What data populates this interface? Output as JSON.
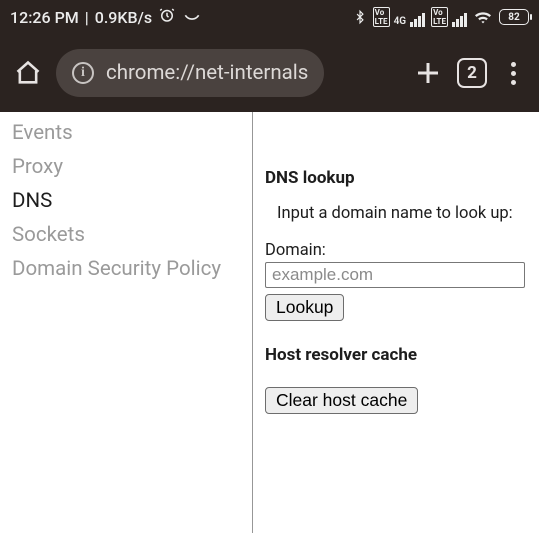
{
  "status": {
    "time": "12:26 PM",
    "net_speed": "0.9KB/s",
    "battery_pct": "82"
  },
  "browser": {
    "url": "chrome://net-internals",
    "tab_count": "2"
  },
  "sidebar": {
    "items": [
      {
        "label": "Events"
      },
      {
        "label": "Proxy"
      },
      {
        "label": "DNS"
      },
      {
        "label": "Sockets"
      },
      {
        "label": "Domain Security Policy"
      }
    ],
    "active_index": 2
  },
  "main": {
    "dns_lookup": {
      "title": "DNS lookup",
      "instruction": "Input a domain name to look up:",
      "field_label": "Domain:",
      "placeholder": "example.com",
      "value": "",
      "button": "Lookup"
    },
    "host_cache": {
      "title": "Host resolver cache",
      "button": "Clear host cache"
    }
  }
}
